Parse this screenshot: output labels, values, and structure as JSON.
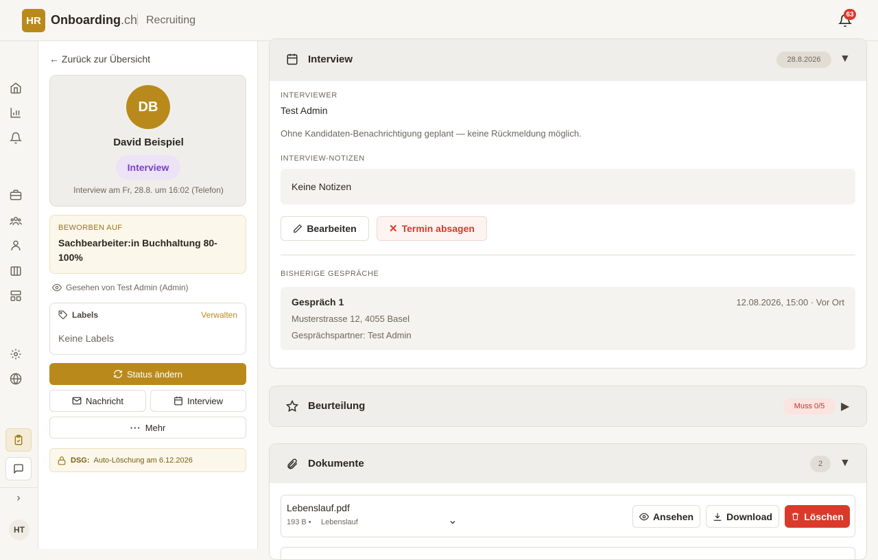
{
  "header": {
    "logo": "HR",
    "brand": "Onboarding",
    "brand_tld": ".ch",
    "section": "Recruiting",
    "notifications": "63"
  },
  "rail": {
    "avatar": "HT"
  },
  "left": {
    "back": "← Zurück zur Übersicht",
    "candidate": {
      "initials": "DB",
      "name": "David Beispiel",
      "status": "Interview",
      "note": "Interview am Fr, 28.8. um 16:02 (Telefon)"
    },
    "applied": {
      "label": "BEWORBEN AUF",
      "job": "Sachbearbeiter:in Buchhaltung 80-100%"
    },
    "seen": "Gesehen von Test Admin (Admin)",
    "labels": {
      "title": "Labels",
      "manage": "Verwalten",
      "empty": "Keine Labels"
    },
    "actions": {
      "status": "Status ändern",
      "message": "Nachricht",
      "interview": "Interview",
      "more": "Mehr"
    },
    "dsg": {
      "bold": "DSG:",
      "text": "Auto-Löschung am 6.12.2026"
    }
  },
  "interview": {
    "title": "Interview",
    "date": "28.8.2026",
    "interviewer_label": "INTERVIEWER",
    "interviewer": "Test Admin",
    "info": "Ohne Kandidaten-Benachrichtigung geplant — keine Rückmeldung möglich.",
    "notes_label": "INTERVIEW-NOTIZEN",
    "notes": "Keine Notizen",
    "edit": "Bearbeiten",
    "cancel": "Termin absagen",
    "history_label": "BISHERIGE GESPRÄCHE",
    "history": {
      "title": "Gespräch 1",
      "when": "12.08.2026, 15:00 · Vor Ort",
      "address": "Musterstrasse 12, 4055 Basel",
      "partner": "Gesprächspartner: Test Admin"
    }
  },
  "rating": {
    "title": "Beurteilung",
    "badge": "Muss 0/5"
  },
  "documents": {
    "title": "Dokumente",
    "count": "2",
    "file": {
      "name": "Lebenslauf.pdf",
      "size": "193 B •",
      "type": "Lebenslauf"
    },
    "view": "Ansehen",
    "download": "Download",
    "delete": "Löschen"
  },
  "colors": {
    "accent": "#b98a1b",
    "danger": "#d93a2b",
    "status_purple": "#7a3ec4"
  }
}
